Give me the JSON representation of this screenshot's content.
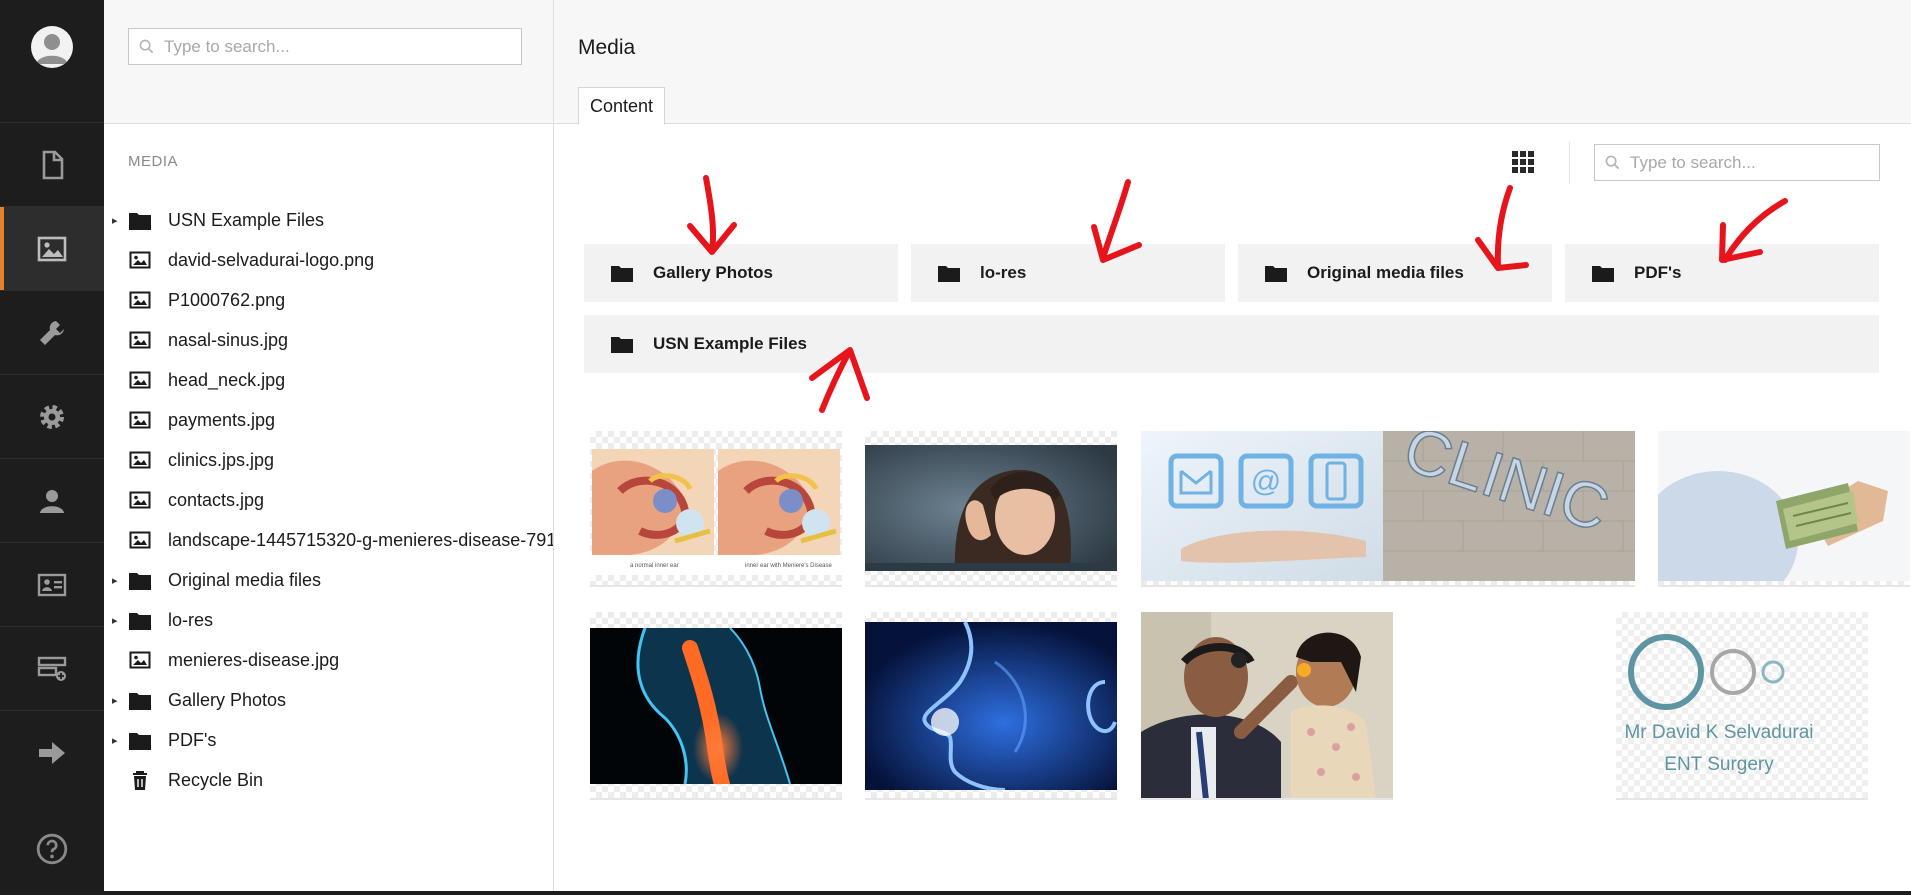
{
  "tree_search": {
    "placeholder": "Type to search..."
  },
  "main_search": {
    "placeholder": "Type to search..."
  },
  "rail": {
    "items": [
      {
        "name": "content-section",
        "icon": "document-icon"
      },
      {
        "name": "media-section",
        "icon": "image-icon",
        "active": true
      },
      {
        "name": "settings-section",
        "icon": "wrench-icon"
      },
      {
        "name": "developer-section",
        "icon": "gear-icon"
      },
      {
        "name": "users-section",
        "icon": "user-icon"
      },
      {
        "name": "members-section",
        "icon": "id-card-icon"
      },
      {
        "name": "forms-section",
        "icon": "form-add-icon"
      },
      {
        "name": "redirect-section",
        "icon": "arrow-right-icon"
      }
    ],
    "help_icon": "question-circle-icon"
  },
  "tree": {
    "section_label": "MEDIA",
    "items": [
      {
        "label": "USN Example Files",
        "type": "folder",
        "expandable": true
      },
      {
        "label": "david-selvadurai-logo.png",
        "type": "image"
      },
      {
        "label": "P1000762.png",
        "type": "image"
      },
      {
        "label": "nasal-sinus.jpg",
        "type": "image"
      },
      {
        "label": "head_neck.jpg",
        "type": "image"
      },
      {
        "label": "payments.jpg",
        "type": "image"
      },
      {
        "label": "clinics.jps.jpg",
        "type": "image"
      },
      {
        "label": "contacts.jpg",
        "type": "image"
      },
      {
        "label": "landscape-1445715320-g-menieres-disease-791",
        "type": "image"
      },
      {
        "label": "Original media files",
        "type": "folder",
        "expandable": true
      },
      {
        "label": "lo-res",
        "type": "folder",
        "expandable": true
      },
      {
        "label": "menieres-disease.jpg",
        "type": "image"
      },
      {
        "label": "Gallery Photos",
        "type": "folder",
        "expandable": true
      },
      {
        "label": "PDF's",
        "type": "folder",
        "expandable": true
      },
      {
        "label": "Recycle Bin",
        "type": "trash"
      }
    ]
  },
  "main": {
    "title": "Media",
    "tab_content": "Content",
    "folders": [
      "Gallery Photos",
      "lo-res",
      "Original media files",
      "PDF's",
      "USN Example Files"
    ],
    "images": [
      {
        "name": "menieres-disease.jpg",
        "captions": [
          "a normal inner ear",
          "inner ear with Meniere's Disease"
        ]
      },
      {
        "name": "landscape-1445715320-g-menieres-disease-791"
      },
      {
        "name": "contacts.jpg"
      },
      {
        "name": "clinics.jps.jpg",
        "text": "CLINIC"
      },
      {
        "name": "payments.jpg"
      },
      {
        "name": "head_neck.jpg"
      },
      {
        "name": "nasal-sinus.jpg"
      },
      {
        "name": "P1000762.png"
      },
      {
        "name": "david-selvadurai-logo.png",
        "line1": "Mr David K Selvadurai",
        "line2": "ENT Surgery"
      }
    ]
  },
  "colors": {
    "accent": "#e5822e",
    "annotation": "#e8141b",
    "rail": "#1d1d1d"
  }
}
